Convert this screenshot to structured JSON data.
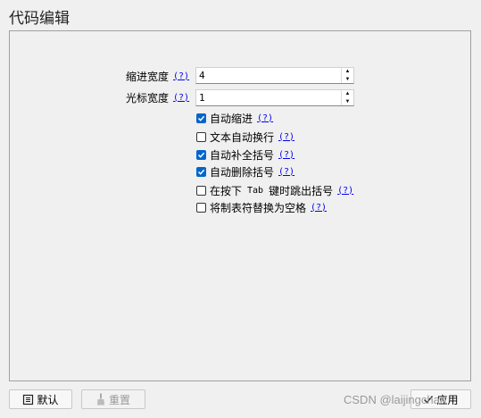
{
  "title": "代码编辑",
  "help_label": "(?)",
  "fields": {
    "indent": {
      "label": "缩进宽度",
      "value": "4"
    },
    "cursor": {
      "label": "光标宽度",
      "value": "1"
    }
  },
  "checkboxes": [
    {
      "label": "自动缩进",
      "checked": true
    },
    {
      "label": "文本自动换行",
      "checked": false
    },
    {
      "label": "自动补全括号",
      "checked": true
    },
    {
      "label": "自动删除括号",
      "checked": true
    },
    {
      "label_before": "在按下",
      "label_key": "Tab",
      "label_after": "键时跳出括号",
      "checked": false
    },
    {
      "label": "将制表符替换为空格",
      "checked": false
    }
  ],
  "buttons": {
    "default": "默认",
    "reset": "重置",
    "apply": "应用"
  },
  "watermark": "CSDN @laijingchan"
}
